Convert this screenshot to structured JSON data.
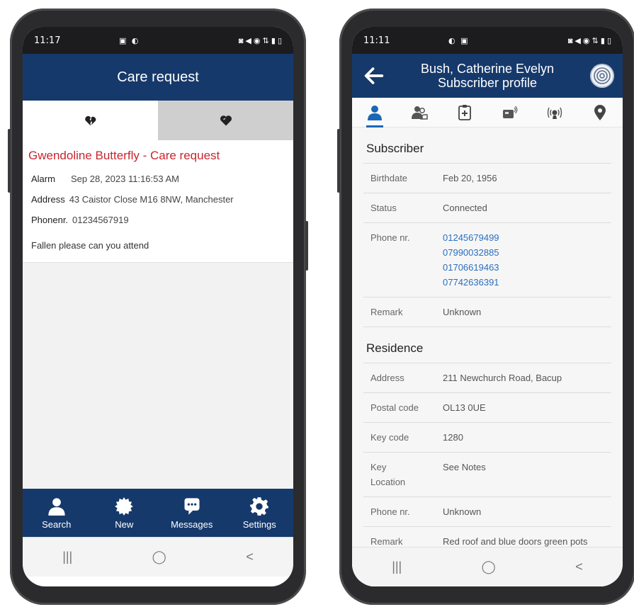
{
  "left": {
    "status": {
      "time": "11:17",
      "system_icons": "▣ ◐",
      "right_icons": "◙ ◀ ◉ ⇅ ▮ ▯"
    },
    "header": {
      "title": "Care request"
    },
    "request": {
      "title": "Gwendoline Butterfly - Care request",
      "alarm_label": "Alarm",
      "alarm_value": "Sep 28, 2023 11:16:53 AM",
      "address_label": "Address",
      "address_value": "43 Caistor Close M16 8NW, Manchester",
      "phone_label": "Phonenr.",
      "phone_value": "01234567919",
      "note": "Fallen please can you attend"
    },
    "bottom_nav": [
      {
        "label": "Search",
        "icon": "person-icon"
      },
      {
        "label": "New",
        "icon": "starburst-icon"
      },
      {
        "label": "Messages",
        "icon": "message-icon"
      },
      {
        "label": "Settings",
        "icon": "gear-icon"
      }
    ],
    "system_nav": {
      "recents": "|||",
      "home": "◯",
      "back": "<"
    }
  },
  "right": {
    "status": {
      "time": "11:11",
      "system_icons": "◐ ▣",
      "right_icons": "◙ ◀ ◉ ⇅ ▮ ▯"
    },
    "header": {
      "name": "Bush, Catherine Evelyn",
      "subtitle": "Subscriber profile"
    },
    "tabs": [
      "person-icon",
      "people-icon",
      "medical-icon",
      "device-icon",
      "alarm-signal-icon",
      "location-icon"
    ],
    "subscriber": {
      "section": "Subscriber",
      "birthdate_label": "Birthdate",
      "birthdate": "Feb 20, 1956",
      "status_label": "Status",
      "status": "Connected",
      "phone_label": "Phone nr.",
      "phones": [
        "01245679499",
        "07990032885",
        "01706619463",
        "07742636391"
      ],
      "remark_label": "Remark",
      "remark": "Unknown"
    },
    "residence": {
      "section": "Residence",
      "address_label": "Address",
      "address": "211 Newchurch Road, Bacup",
      "postal_label": "Postal code",
      "postal": "OL13 0UE",
      "keycode_label": "Key code",
      "keycode": "1280",
      "keyloc_label1": "Key",
      "keyloc_label2": "Location",
      "keyloc": "See Notes",
      "phone_label": "Phone nr.",
      "phone": "Unknown",
      "remark_label": "Remark",
      "remark": "Red roof and blue doors green pots"
    },
    "system_nav": {
      "recents": "|||",
      "home": "◯",
      "back": "<"
    }
  },
  "colors": {
    "header": "#16396b",
    "request_title": "#c8262e",
    "link": "#2a6fc0",
    "tab_active": "#1b67b5"
  }
}
